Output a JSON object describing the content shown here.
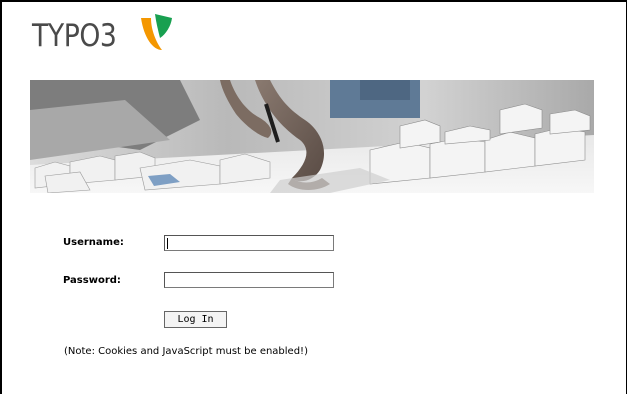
{
  "app": {
    "logo_text": "TYPO3",
    "logo_icon": "typo3-logo-icon"
  },
  "banner": {
    "image": "hands-architectural-model-photo"
  },
  "login": {
    "username_label": "Username:",
    "username_value": "",
    "password_label": "Password:",
    "password_value": "",
    "submit_label": "Log In",
    "note": "(Note: Cookies and JavaScript must be enabled!)"
  },
  "colors": {
    "logo_orange": "#f49700",
    "logo_green": "#18a050",
    "logo_text": "#4a4a4a"
  }
}
